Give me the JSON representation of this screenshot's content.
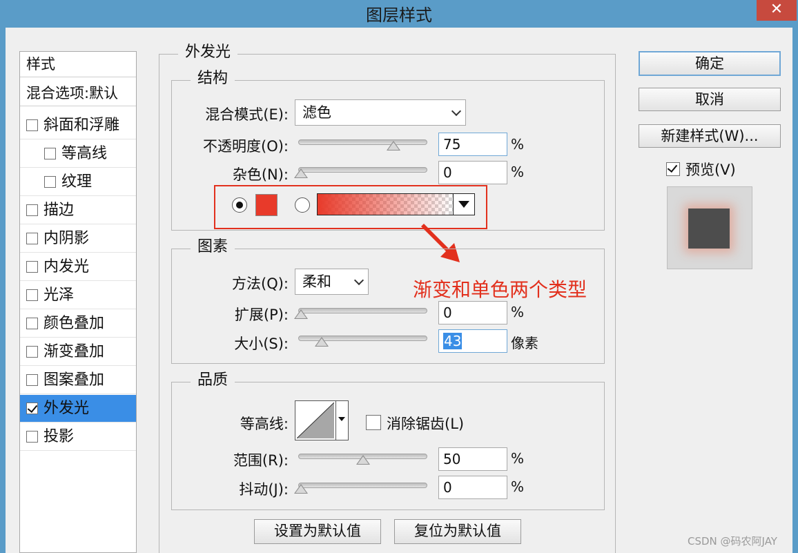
{
  "window": {
    "title": "图层样式",
    "close_glyph": "✕"
  },
  "sidebar": {
    "header": "样式",
    "blend_options": "混合选项:默认",
    "items": [
      {
        "label": "斜面和浮雕",
        "checked": false
      },
      {
        "label": "等高线",
        "checked": false
      },
      {
        "label": "纹理",
        "checked": false
      },
      {
        "label": "描边",
        "checked": false
      },
      {
        "label": "内阴影",
        "checked": false
      },
      {
        "label": "内发光",
        "checked": false
      },
      {
        "label": "光泽",
        "checked": false
      },
      {
        "label": "颜色叠加",
        "checked": false
      },
      {
        "label": "渐变叠加",
        "checked": false
      },
      {
        "label": "图案叠加",
        "checked": false
      },
      {
        "label": "外发光",
        "checked": true
      },
      {
        "label": "投影",
        "checked": false
      }
    ]
  },
  "outer_glow": {
    "title": "外发光",
    "structure": {
      "title": "结构",
      "blend_mode_label": "混合模式(E):",
      "blend_mode_value": "滤色",
      "opacity_label": "不透明度(O):",
      "opacity_value": "75",
      "opacity_unit": "%",
      "noise_label": "杂色(N):",
      "noise_value": "0",
      "noise_unit": "%",
      "color_swatch": "#e83a2a",
      "solid_selected": true
    },
    "elements": {
      "title": "图素",
      "method_label": "方法(Q):",
      "method_value": "柔和",
      "spread_label": "扩展(P):",
      "spread_value": "0",
      "spread_unit": "%",
      "size_label": "大小(S):",
      "size_value": "43",
      "size_unit": "像素"
    },
    "quality": {
      "title": "品质",
      "contour_label": "等高线:",
      "anti_alias_label": "消除锯齿(L)",
      "anti_alias_checked": false,
      "range_label": "范围(R):",
      "range_value": "50",
      "range_unit": "%",
      "jitter_label": "抖动(J):",
      "jitter_value": "0",
      "jitter_unit": "%"
    },
    "make_default_label": "设置为默认值",
    "reset_default_label": "复位为默认值"
  },
  "annotation": {
    "text": "渐变和单色两个类型",
    "color": "#e2301d"
  },
  "buttons": {
    "ok": "确定",
    "cancel": "取消",
    "new_style": "新建样式(W)...",
    "preview_label": "预览(V)",
    "preview_checked": true
  },
  "sliders": {
    "opacity": 0.75,
    "noise": 0.0,
    "spread": 0.0,
    "size": 0.17,
    "range": 0.5,
    "jitter": 0.0
  },
  "watermark": "CSDN @码农阿JAY"
}
